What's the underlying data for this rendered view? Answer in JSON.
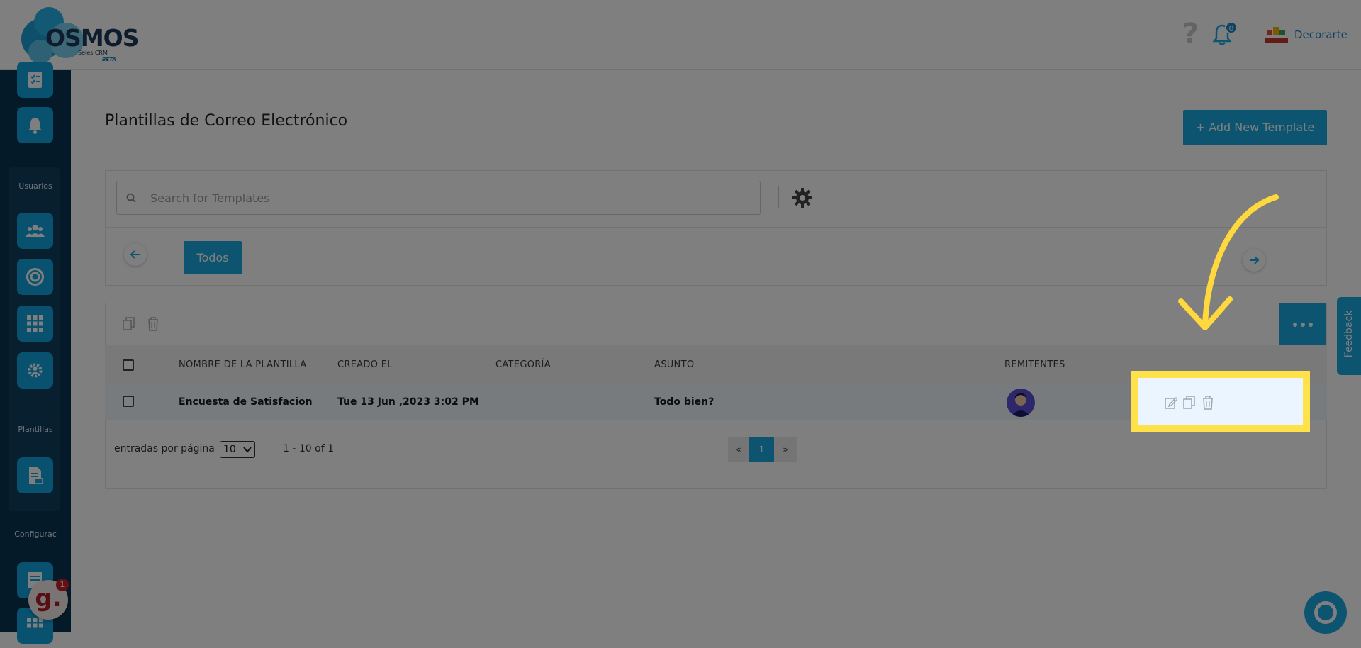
{
  "app": {
    "logo_text": "OSMOS",
    "logo_sub": "Sales CRM",
    "logo_beta": "BETA",
    "company_name": "Decorarte",
    "notification_count": "0",
    "help_label": "?"
  },
  "sidebar": {
    "sections": [
      {
        "label": "Usuarios"
      },
      {
        "label": "Plantillas"
      },
      {
        "label": "Configurac"
      }
    ]
  },
  "page": {
    "title": "Plantillas de Correo Electrónico",
    "add_button": "+ Add New Template"
  },
  "search": {
    "placeholder": "Search for Templates"
  },
  "tabs": [
    {
      "label": "Todos",
      "active": true
    }
  ],
  "table": {
    "columns": [
      "NOMBRE DE LA PLANTILLA",
      "CREADO EL",
      "CATEGORÍA",
      "ASUNTO",
      "REMITENTES"
    ],
    "rows": [
      {
        "name": "Encuesta de Satisfacion",
        "created": "Tue 13 Jun ,2023 3:02 PM",
        "category": "",
        "subject": "Todo bien?"
      }
    ]
  },
  "pagination": {
    "per_page_label": "entradas por página",
    "per_page_value": "10",
    "range": "1 - 10 of 1",
    "prev": "«",
    "current": "1",
    "next": "»"
  },
  "widgets": {
    "feedback_label": "Feedback",
    "g_badge": "1",
    "g_letter": "g."
  },
  "colors": {
    "primary": "#1aa8e2",
    "sidebar": "#0b3551",
    "highlight": "#ffe14a"
  }
}
